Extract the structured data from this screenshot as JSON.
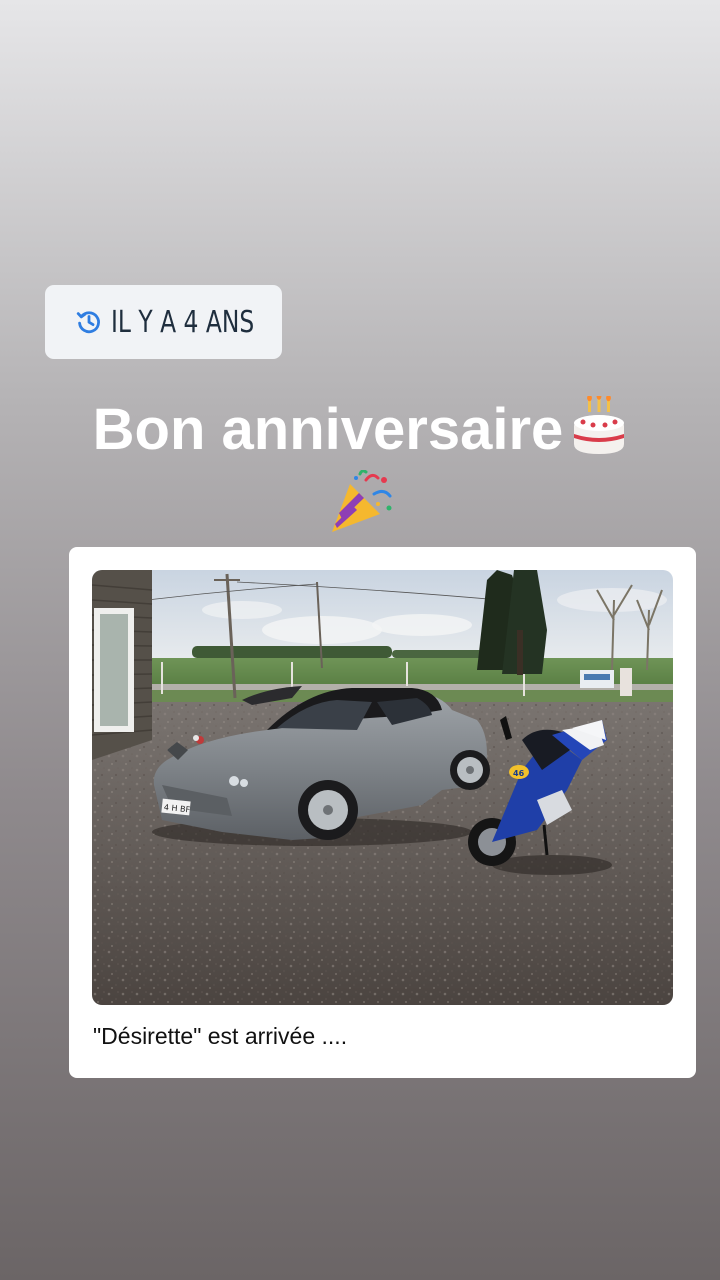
{
  "memory_badge": {
    "icon": "history-clock-icon",
    "label": "IL Y A 4 ANS"
  },
  "headline": {
    "text": "Bon anniversaire",
    "emoji_1": "birthday-cake-emoji",
    "emoji_2": "party-popper-emoji"
  },
  "post": {
    "photo_subject": "grey convertible car and blue sport motorcycle on gravel",
    "license_plate_text": "4 H  BF",
    "caption": "\"Désirette\" est arrivée ...."
  },
  "colors": {
    "badge_bg": "#f1f3f6",
    "badge_text": "#1f2e3e",
    "badge_icon": "#2f7de1",
    "headline": "#ffffff",
    "card_bg": "#ffffff"
  }
}
